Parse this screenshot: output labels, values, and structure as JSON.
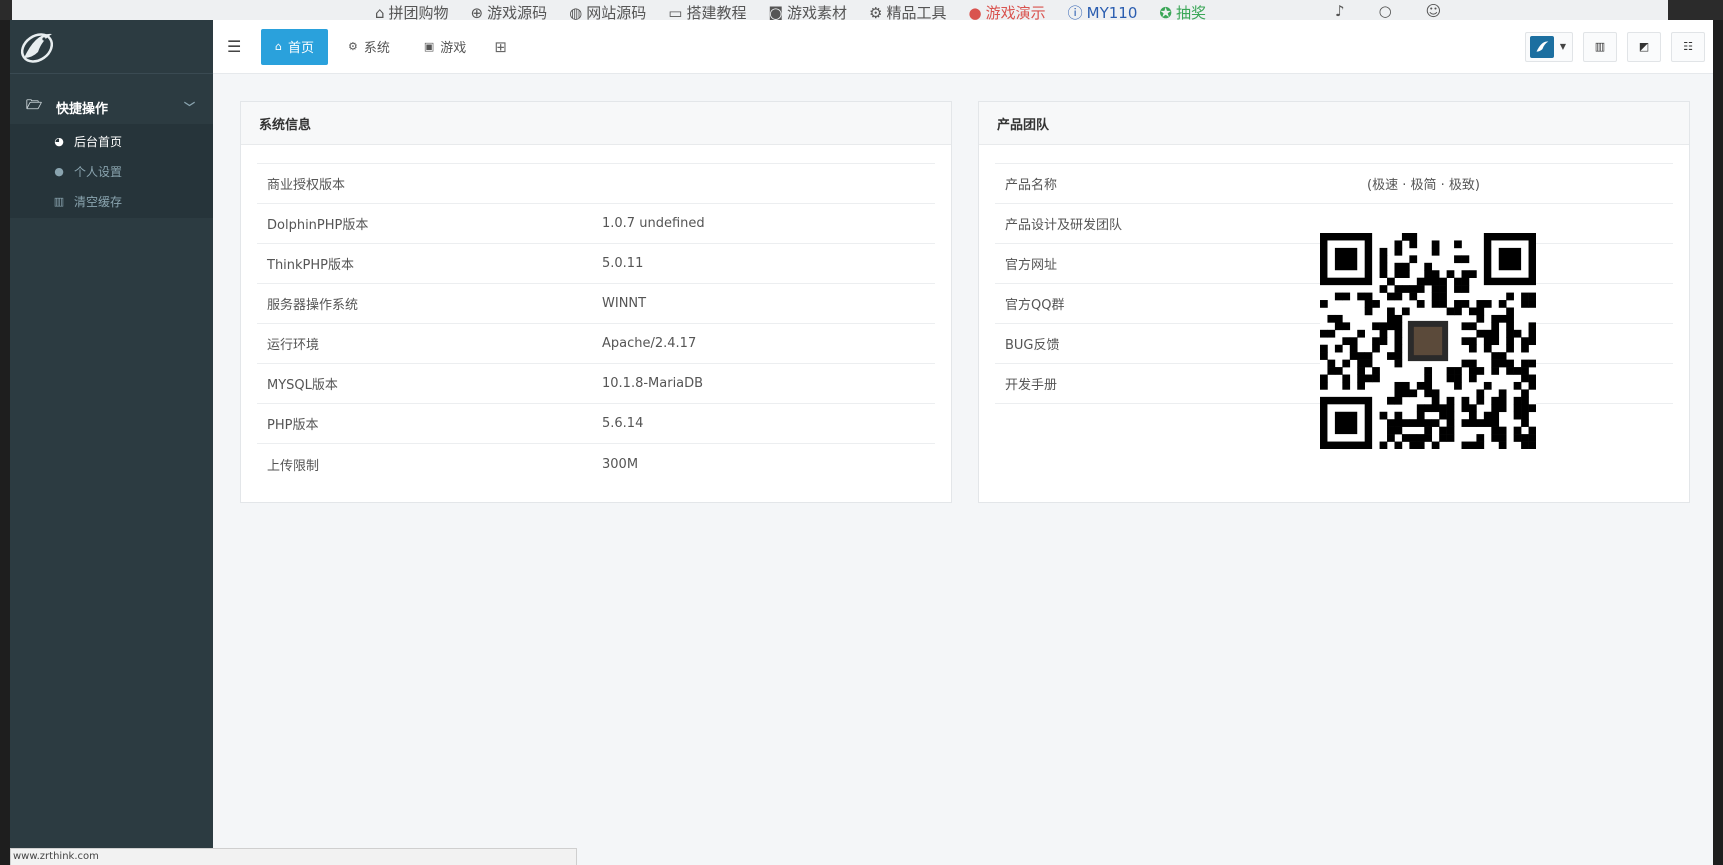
{
  "browser_nav": {
    "items": [
      {
        "icon": "cart-icon",
        "label": "拼团购物"
      },
      {
        "icon": "gamepad-icon",
        "label": "游戏源码"
      },
      {
        "icon": "globe-icon",
        "label": "网站源码"
      },
      {
        "icon": "monitor-icon",
        "label": "搭建教程"
      },
      {
        "icon": "camera-icon",
        "label": "游戏素材"
      },
      {
        "icon": "gear-icon",
        "label": "精品工具"
      },
      {
        "icon": "pin-icon",
        "label": "游戏演示"
      },
      {
        "icon": "info-icon",
        "label": "MY110"
      },
      {
        "icon": "gift-icon",
        "label": "抽奖"
      }
    ]
  },
  "sidebar": {
    "group_label": "快捷操作",
    "items": [
      {
        "label": "后台首页",
        "icon": "dashboard-icon",
        "active": true
      },
      {
        "label": "个人设置",
        "icon": "user-icon",
        "active": false
      },
      {
        "label": "清空缓存",
        "icon": "trash-icon",
        "active": false
      }
    ]
  },
  "header": {
    "tabs": [
      {
        "label": "首页",
        "icon": "home-icon",
        "active": true
      },
      {
        "label": "系统",
        "icon": "gear-icon",
        "active": false
      },
      {
        "label": "游戏",
        "icon": "game-icon",
        "active": false
      }
    ]
  },
  "system_info": {
    "title": "系统信息",
    "rows": [
      {
        "key": "商业授权版本",
        "value": ""
      },
      {
        "key": "DolphinPHP版本",
        "value": "1.0.7 undefined"
      },
      {
        "key": "ThinkPHP版本",
        "value": "5.0.11"
      },
      {
        "key": "服务器操作系统",
        "value": "WINNT"
      },
      {
        "key": "运行环境",
        "value": "Apache/2.4.17"
      },
      {
        "key": "MYSQL版本",
        "value": "10.1.8-MariaDB"
      },
      {
        "key": "PHP版本",
        "value": "5.6.14"
      },
      {
        "key": "上传限制",
        "value": "300M"
      }
    ]
  },
  "product_team": {
    "title": "产品团队",
    "rows": [
      {
        "key": "产品名称",
        "value": "(极速 · 极简 · 极致)"
      },
      {
        "key": "产品设计及研发团队",
        "value": ""
      },
      {
        "key": "官方网址",
        "value": ""
      },
      {
        "key": "官方QQ群",
        "value": ""
      },
      {
        "key": "BUG反馈",
        "value": ""
      },
      {
        "key": "开发手册",
        "value": ""
      },
      {
        "key": "",
        "value": ""
      }
    ]
  },
  "status_bar": {
    "url": "www.zrthink.com"
  },
  "colors": {
    "sidebar_bg": "#2c3b41",
    "accent": "#2aa1dc",
    "page_bg": "#f4f6f8"
  }
}
